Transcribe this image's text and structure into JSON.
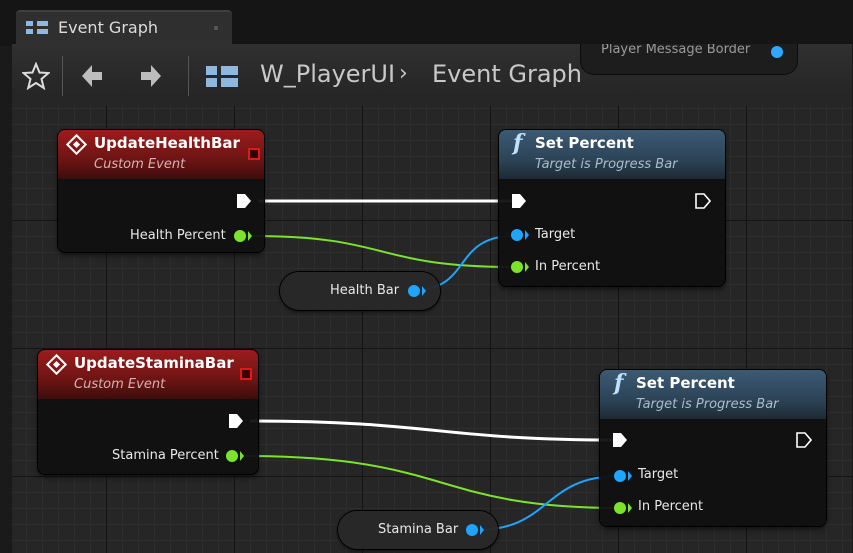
{
  "tab": {
    "label": "Event Graph",
    "icon": "blueprint-graph-icon"
  },
  "toolbar": {
    "favorite_icon": "star-icon",
    "back_icon": "arrow-left-icon",
    "forward_icon": "arrow-right-icon",
    "breadcrumb": {
      "root": "W_PlayerUI",
      "separator": "›",
      "current": "Event Graph"
    }
  },
  "graph": {
    "offscreen_node": {
      "pin_label": "Player Message Border"
    },
    "nodes": {
      "update_health": {
        "title": "UpdateHealthBar",
        "subtitle": "Custom Event",
        "pin_label": "Health Percent"
      },
      "set_percent_1": {
        "title": "Set Percent",
        "subtitle": "Target is Progress Bar",
        "target_label": "Target",
        "in_percent_label": "In Percent"
      },
      "health_bar_getter": {
        "label": "Health Bar"
      },
      "update_stamina": {
        "title": "UpdateStaminaBar",
        "subtitle": "Custom Event",
        "pin_label": "Stamina Percent"
      },
      "set_percent_2": {
        "title": "Set Percent",
        "subtitle": "Target is Progress Bar",
        "target_label": "Target",
        "in_percent_label": "In Percent"
      },
      "stamina_bar_getter": {
        "label": "Stamina Bar"
      }
    }
  },
  "colors": {
    "event_header": "#9c1c1c",
    "function_header": "#3b5a74",
    "float_pin": "#7ce32d",
    "object_pin": "#1fa4ff",
    "exec_wire": "#ffffff"
  }
}
